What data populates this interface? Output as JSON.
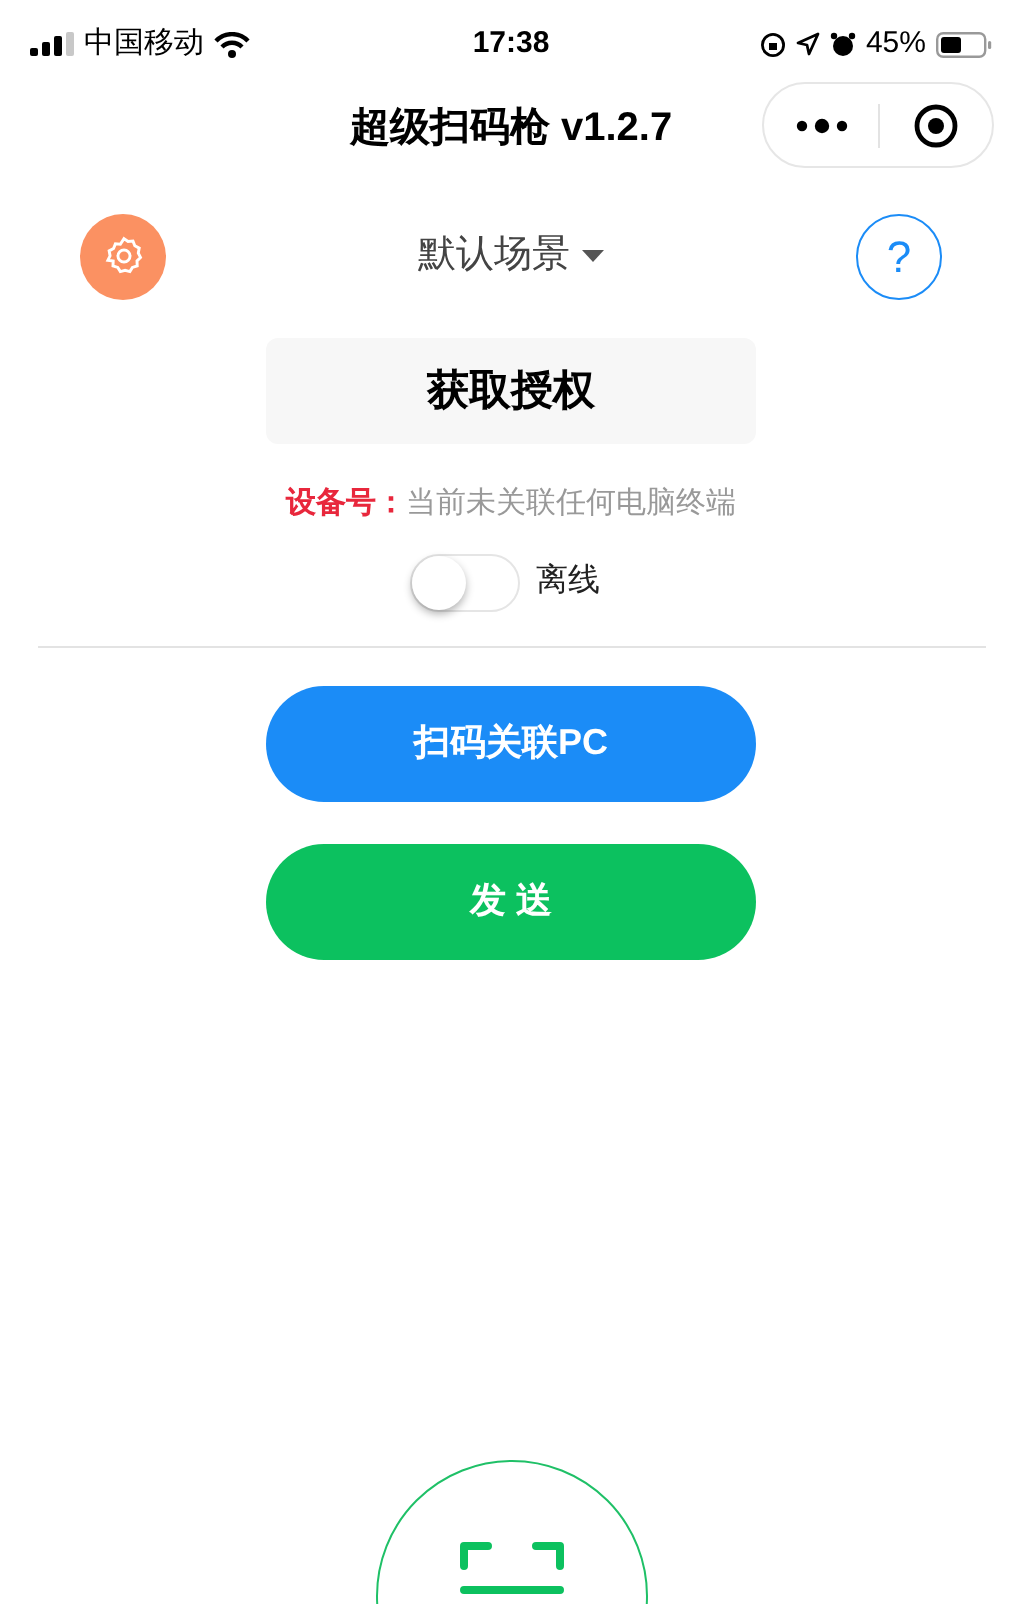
{
  "status_bar": {
    "carrier": "中国移动",
    "time": "17:38",
    "battery": "45%"
  },
  "nav_bar": {
    "title": "超级扫码枪 v1.2.7"
  },
  "scene_selector": {
    "label": "默认场景"
  },
  "help_button": {
    "label": "?"
  },
  "authorize_button": {
    "label": "获取授权"
  },
  "device": {
    "label": "设备号：",
    "value": "当前未关联任何电脑终端"
  },
  "connection_toggle": {
    "on": false,
    "label": "离线"
  },
  "buttons": [
    {
      "label": "扫码关联PC",
      "kind": "primary"
    },
    {
      "label": "发 送",
      "kind": "success"
    }
  ]
}
